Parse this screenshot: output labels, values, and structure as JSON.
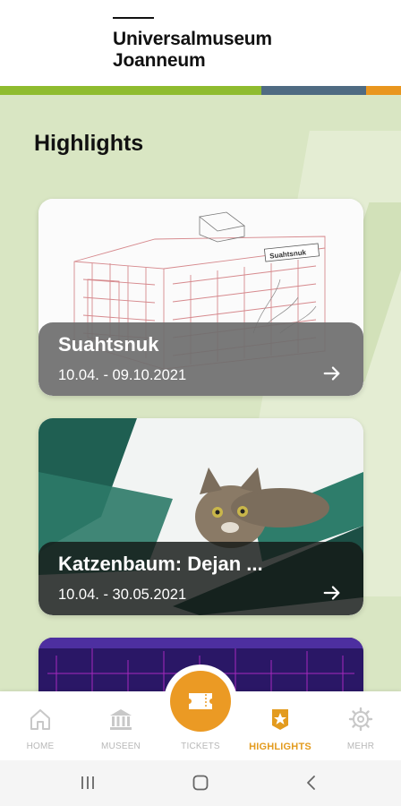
{
  "brand": {
    "line1": "Universalmuseum",
    "line2": "Joanneum"
  },
  "page": {
    "title": "Highlights"
  },
  "cards": [
    {
      "title": "Suahtsnuk",
      "date": "10.04. - 09.10.2021",
      "image_text": "Suahtsnuk"
    },
    {
      "title": "Katzenbaum: Dejan ...",
      "date": "10.04. - 30.05.2021"
    }
  ],
  "nav": {
    "items": [
      {
        "label": "HOME",
        "icon": "home-icon"
      },
      {
        "label": "MUSEEN",
        "icon": "museum-icon"
      },
      {
        "label": "TICKETS",
        "icon": "ticket-icon"
      },
      {
        "label": "HIGHLIGHTS",
        "icon": "star-badge-icon",
        "active": true
      },
      {
        "label": "MEHR",
        "icon": "gear-icon"
      }
    ],
    "active_color": "#e39b1e"
  },
  "colors": {
    "green": "#8fbc2f",
    "slate": "#4f6b82",
    "orange": "#e9961f",
    "background": "#d9e6c3"
  },
  "system_nav": [
    "recent-apps-icon",
    "home-button-icon",
    "back-icon"
  ]
}
